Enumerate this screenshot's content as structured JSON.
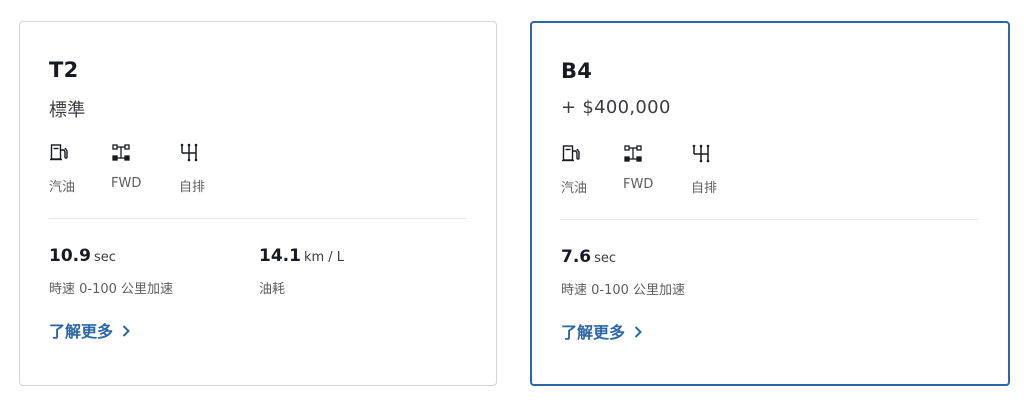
{
  "trims": [
    {
      "name": "T2",
      "price": "標準",
      "selected": false,
      "specs": [
        {
          "icon": "fuel-pump-icon",
          "label": "汽油"
        },
        {
          "icon": "drivetrain-icon",
          "label": "FWD"
        },
        {
          "icon": "gear-shift-icon",
          "label": "自排"
        }
      ],
      "metrics": [
        {
          "value": "10.9",
          "unit": "sec",
          "label": "時速 0-100 公里加速"
        },
        {
          "value": "14.1",
          "unit": "km / L",
          "label": "油耗"
        }
      ],
      "learn_more": "了解更多"
    },
    {
      "name": "B4",
      "price": "+ $400,000",
      "selected": true,
      "specs": [
        {
          "icon": "fuel-pump-icon",
          "label": "汽油"
        },
        {
          "icon": "drivetrain-icon",
          "label": "FWD"
        },
        {
          "icon": "gear-shift-icon",
          "label": "自排"
        }
      ],
      "metrics": [
        {
          "value": "7.6",
          "unit": "sec",
          "label": "時速 0-100 公里加速"
        }
      ],
      "learn_more": "了解更多"
    }
  ],
  "colors": {
    "accent": "#2b66a8",
    "border": "#d6d6d6",
    "text_primary": "#171a20",
    "text_secondary": "#5c5e62"
  }
}
